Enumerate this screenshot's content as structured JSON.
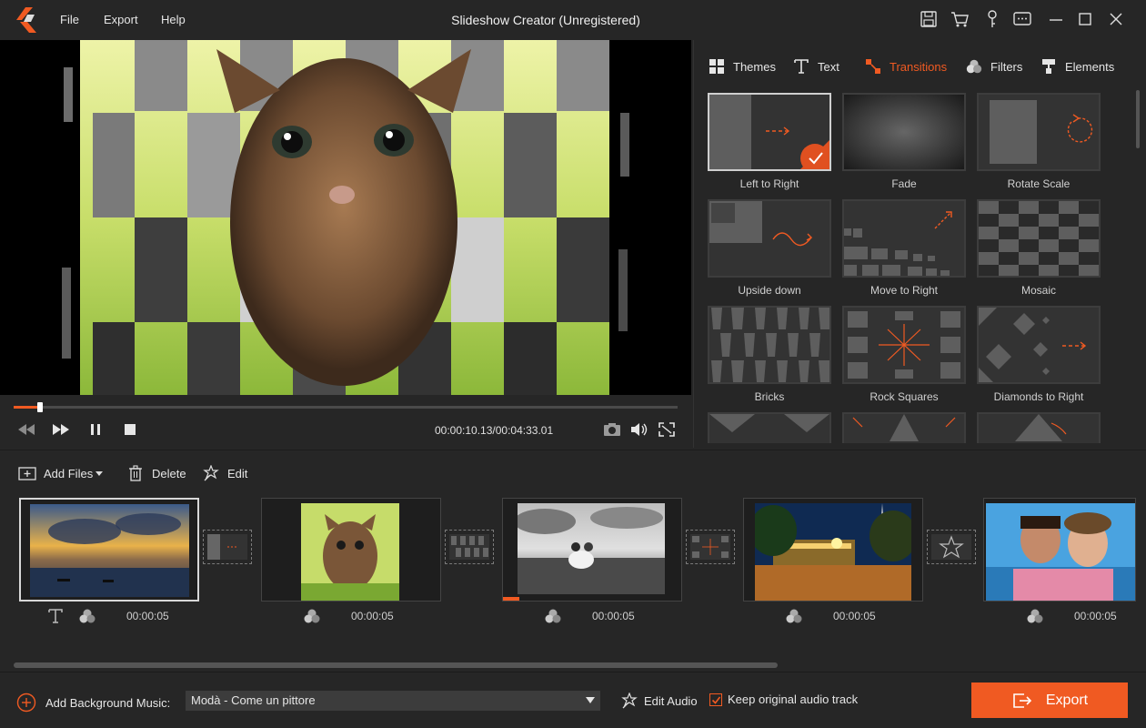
{
  "app": {
    "title": "Slideshow Creator (Unregistered)"
  },
  "menu": [
    "File",
    "Export",
    "Help"
  ],
  "titlebar_icons": [
    "save-icon",
    "cart-icon",
    "key-icon",
    "feedback-icon",
    "minimize-icon",
    "maximize-icon",
    "close-icon"
  ],
  "player": {
    "timecode": "00:00:10.13/00:04:33.01",
    "progress_fraction": 0.04
  },
  "panel": {
    "tabs": [
      {
        "label": "Themes",
        "icon": "themes-icon",
        "active": false
      },
      {
        "label": "Text",
        "icon": "text-icon",
        "active": false
      },
      {
        "label": "Transitions",
        "icon": "transitions-icon",
        "active": true
      },
      {
        "label": "Filters",
        "icon": "filters-icon",
        "active": false
      },
      {
        "label": "Elements",
        "icon": "elements-icon",
        "active": false
      }
    ],
    "transitions": [
      "Left to Right",
      "Fade",
      "Rotate Scale",
      "Upside down",
      "Move to Right",
      "Mosaic",
      "Bricks",
      "Rock Squares",
      "Diamonds to Right"
    ],
    "selected_transition": "Left to Right"
  },
  "toolbar": {
    "add_files": "Add Files",
    "delete": "Delete",
    "edit": "Edit"
  },
  "timeline": {
    "clips": [
      {
        "duration": "00:00:05",
        "subject": "sunset-photo",
        "has_text_icon": true,
        "selected": true
      },
      {
        "duration": "00:00:05",
        "subject": "kitten-photo",
        "has_text_icon": false,
        "selected": false
      },
      {
        "duration": "00:00:05",
        "subject": "couple-bw-photo",
        "has_text_icon": false,
        "selected": false
      },
      {
        "duration": "00:00:05",
        "subject": "night-park-photo",
        "has_text_icon": false,
        "selected": false
      },
      {
        "duration": "00:00:05",
        "subject": "selfie-photo",
        "has_text_icon": false,
        "selected": false
      }
    ]
  },
  "bottom": {
    "add_music_label": "Add Background Music:",
    "music_value": "Modà - Come un pittore",
    "edit_audio": "Edit Audio",
    "keep_original": "Keep original audio track",
    "keep_original_checked": true,
    "export_label": "Export"
  },
  "colors": {
    "accent": "#f05a22",
    "background": "#262626"
  }
}
